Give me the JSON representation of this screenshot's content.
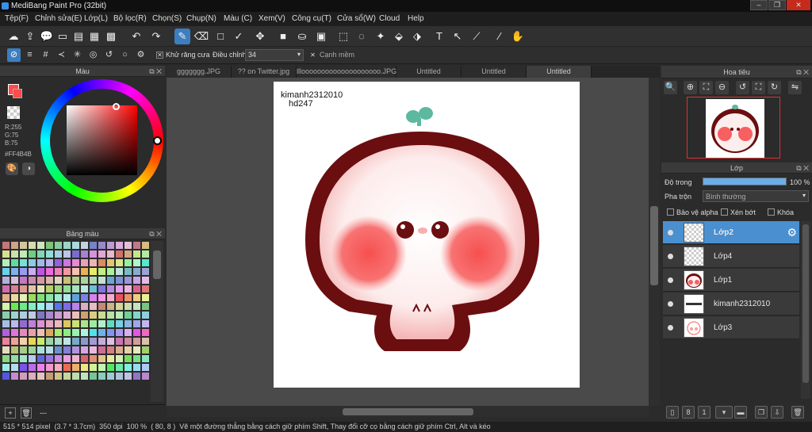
{
  "app": {
    "title": "MediBang Paint Pro (32bit)"
  },
  "menu": [
    "Tệp(F)",
    "Chỉnh sửa(E)",
    "Lớp(L)",
    "Bộ lọc(R)",
    "Chọn(S)",
    "Chụp(N)",
    "Màu (C)",
    "Xem(V)",
    "Công cụ(T)",
    "Cửa sổ(W)",
    "Cloud",
    "Help"
  ],
  "toolbar2": {
    "antialias_label": "Khử răng cưa",
    "adjust_label": "Điều chỉnh",
    "adjust_value": "34",
    "smooth_label": "Cạnh mềm"
  },
  "color_panel": {
    "title": "Màu",
    "r": "R:255",
    "g": "G:75",
    "b": "B:75",
    "hex": "#FF4B4B",
    "current_color": "#FF4B4B"
  },
  "palette_panel": {
    "title": "Bảng màu",
    "footer": "---"
  },
  "tabs": [
    "ggggggg.JPG",
    "?? on Twitter.jpg",
    "llloooooooooooooooooooo.JPG",
    "Untitled",
    "Untitled",
    "Untitled"
  ],
  "canvas": {
    "text_line1": "kimanh2312010",
    "text_line2": "hd247"
  },
  "navigator": {
    "title": "Hoa tiêu"
  },
  "layers": {
    "title": "Lớp",
    "opacity_label": "Độ trong",
    "opacity_value": "100 %",
    "opacity_fraction": 1.0,
    "blend_label": "Pha trộn",
    "blend_value": "Bình thường",
    "protect_alpha": "Bảo vệ alpha",
    "clipping": "Xén bớt",
    "lock": "Khóa",
    "items": [
      {
        "name": "Lớp2"
      },
      {
        "name": "Lớp4"
      },
      {
        "name": "Lớp1"
      },
      {
        "name": "kimanh2312010"
      },
      {
        "name": "Lớp3"
      }
    ]
  },
  "status": {
    "size": "515 * 514 pixel",
    "cm": "(3.7 * 3.7cm)",
    "dpi": "350 dpi",
    "zoom": "100 %",
    "coords": "( 80, 8 )",
    "hint": "Vẽ một đường thẳng bằng cách giữ phím Shift, Thay đổi cỡ cọ bằng cách giữ phím Ctrl, Alt và kéo"
  },
  "colors": {
    "accent": "#3C7FC0",
    "brown": "#6B0E10",
    "cheek": "#F76060"
  }
}
